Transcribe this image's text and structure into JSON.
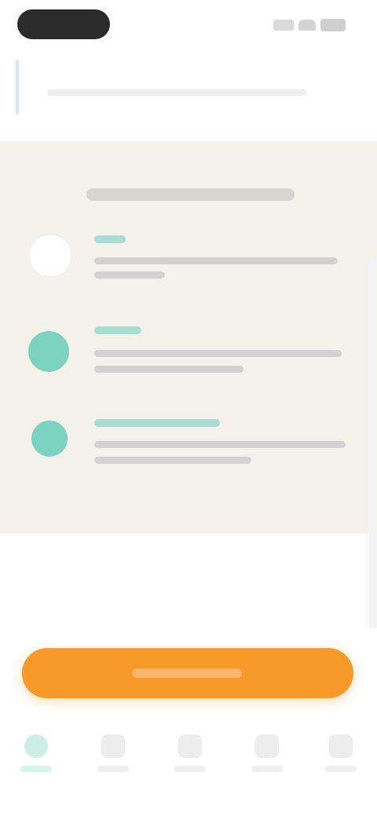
{
  "colors": {
    "accent": "#5fcbb8",
    "cta": "#f79a2a",
    "content_background": "#f5f2ec",
    "status_pill": "#2b2b2b"
  },
  "status_bar": {
    "icons": [
      "signal-icon",
      "wifi-icon",
      "battery-icon"
    ]
  },
  "header": {
    "back_icon": "chevron-left-icon"
  },
  "steps": [
    {
      "icon": "circle-icon",
      "state": "pending"
    },
    {
      "icon": "check-circle-icon",
      "state": "done"
    },
    {
      "icon": "check-circle-icon",
      "state": "done"
    }
  ],
  "tabs": [
    {
      "icon": "home-icon",
      "active": true
    },
    {
      "icon": "tab-icon",
      "active": false
    },
    {
      "icon": "tab-icon",
      "active": false
    },
    {
      "icon": "tab-icon",
      "active": false
    },
    {
      "icon": "tab-icon",
      "active": false
    }
  ]
}
